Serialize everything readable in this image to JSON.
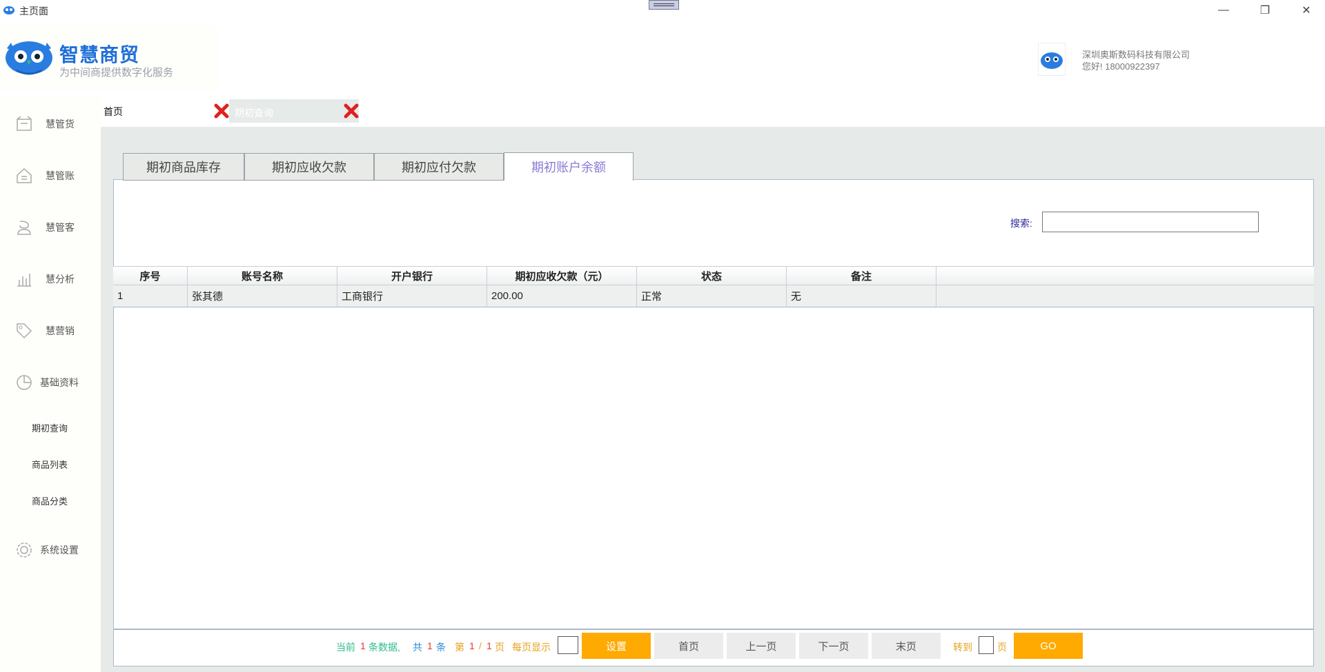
{
  "window": {
    "title": "主页面",
    "controls": {
      "minimize": "—",
      "restore": "❐",
      "close": "✕"
    }
  },
  "logo": {
    "brand": "智慧商贸",
    "tagline": "为中间商提供数字化服务"
  },
  "user": {
    "company": "深圳奥斯数码科技有限公司",
    "greeting": "您好! 18000922397"
  },
  "sidebar": {
    "items": [
      {
        "label": "慧管货",
        "icon": "warehouse-icon"
      },
      {
        "label": "慧管账",
        "icon": "house-icon"
      },
      {
        "label": "慧管客",
        "icon": "customer-icon"
      },
      {
        "label": "慧分析",
        "icon": "bar-chart-icon"
      },
      {
        "label": "慧营销",
        "icon": "tag-icon"
      },
      {
        "label": "基础资料",
        "icon": "pie-chart-icon"
      }
    ],
    "subitems": [
      "期初查询",
      "商品列表",
      "商品分类"
    ],
    "settings": {
      "label": "系统设置",
      "icon": "gear-icon"
    }
  },
  "page_tabs": {
    "home": "首页",
    "current": "期初查询"
  },
  "tabs": [
    "期初商品库存",
    "期初应收欠款",
    "期初应付欠款",
    "期初账户余额"
  ],
  "active_tab": "期初账户余额",
  "search": {
    "label": "搜索:",
    "value": ""
  },
  "table": {
    "columns": [
      "序号",
      "账号名称",
      "开户银行",
      "期初应收欠款（元）",
      "状态",
      "备注"
    ],
    "rows": [
      [
        "1",
        "张其德",
        "工商银行",
        "200.00",
        "正常",
        "无"
      ]
    ]
  },
  "pager": {
    "current_prefix": "当前",
    "current_count": "1",
    "current_suffix": "条数据,",
    "total_prefix": "共",
    "total_count": "1",
    "total_suffix": "条",
    "page_prefix": "第",
    "page_current": "1",
    "page_sep": "/",
    "page_total": "1",
    "page_suffix": "页",
    "per_page_label": "每页显示",
    "set_button": "设置",
    "first_button": "首页",
    "prev_button": "上一页",
    "next_button": "下一页",
    "last_button": "末页",
    "goto_label": "转到",
    "goto_suffix": "页",
    "go_button": "GO"
  },
  "colors": {
    "brand": "#1f6fd8",
    "accent": "#ffaa00",
    "active_tab": "#8a7ad6"
  }
}
